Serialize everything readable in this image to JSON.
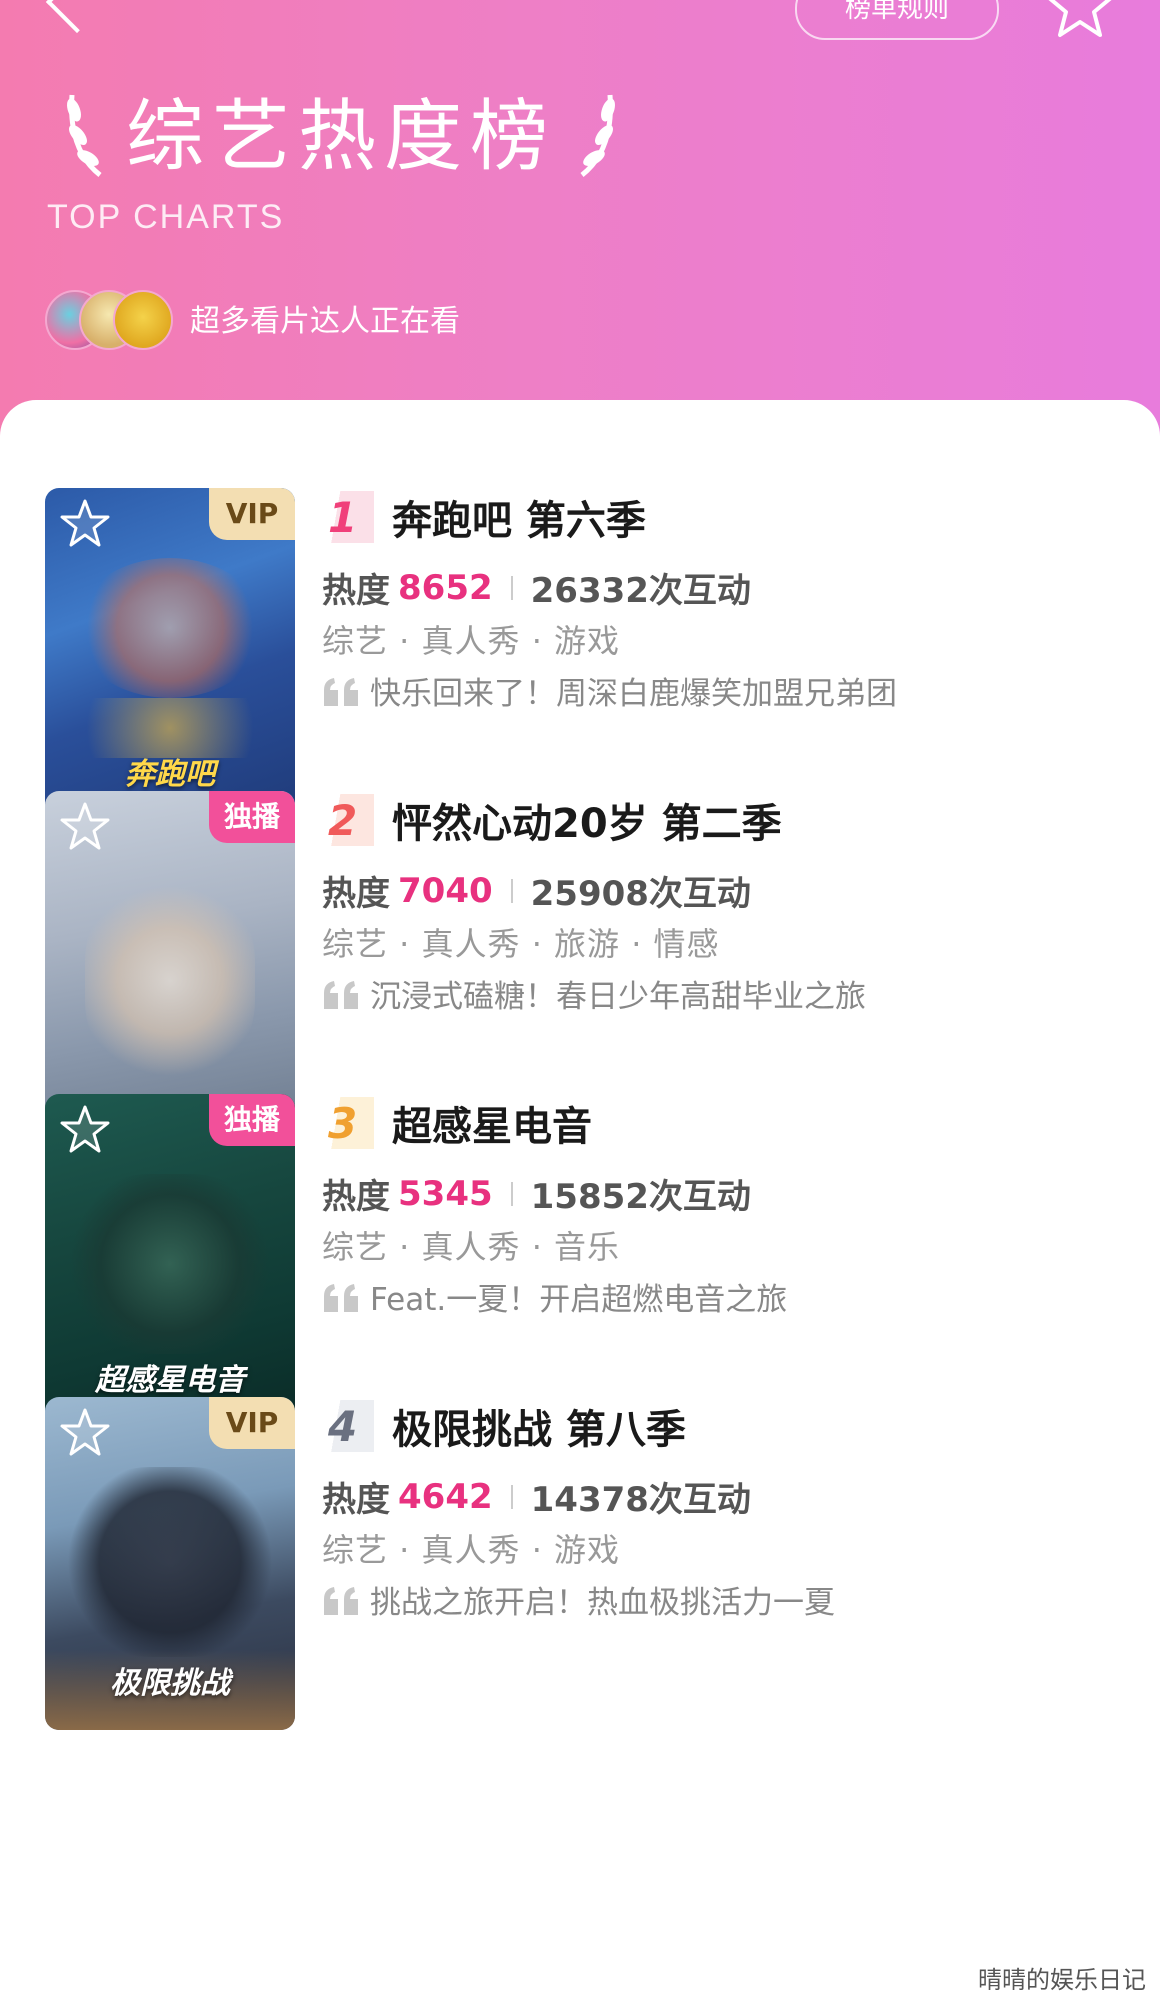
{
  "header": {
    "rules_label": "榜单规则",
    "title": "综艺热度榜",
    "subtitle": "TOP CHARTS",
    "watching_text": "超多看片达人正在看"
  },
  "colors": {
    "accent": "#e8317f",
    "header_gradient_start": "#f47bb0",
    "header_gradient_end": "#e87cdc"
  },
  "items": [
    {
      "rank": "1",
      "title": "奔跑吧 第六季",
      "heat_label": "热度",
      "heat_value": "8652",
      "interactions": "26332次互动",
      "tags": "综艺 · 真人秀 · 游戏",
      "quote": "快乐回来了！周深白鹿爆笑加盟兄弟团",
      "badge": "VIP",
      "poster_caption": "奔跑吧"
    },
    {
      "rank": "2",
      "title": "怦然心动20岁 第二季",
      "heat_label": "热度",
      "heat_value": "7040",
      "interactions": "25908次互动",
      "tags": "综艺 · 真人秀 · 旅游 · 情感",
      "quote": "沉浸式磕糖！春日少年高甜毕业之旅",
      "badge": "独播",
      "poster_caption": ""
    },
    {
      "rank": "3",
      "title": "超感星电音",
      "heat_label": "热度",
      "heat_value": "5345",
      "interactions": "15852次互动",
      "tags": "综艺 · 真人秀 · 音乐",
      "quote": "Feat.一夏！开启超燃电音之旅",
      "badge": "独播",
      "poster_caption": "超感星电音"
    },
    {
      "rank": "4",
      "title": "极限挑战 第八季",
      "heat_label": "热度",
      "heat_value": "4642",
      "interactions": "14378次互动",
      "tags": "综艺 · 真人秀 · 游戏",
      "quote": "挑战之旅开启！热血极挑活力一夏",
      "badge": "VIP",
      "poster_caption": "极限挑战"
    }
  ],
  "watermark": "晴晴的娱乐日记"
}
